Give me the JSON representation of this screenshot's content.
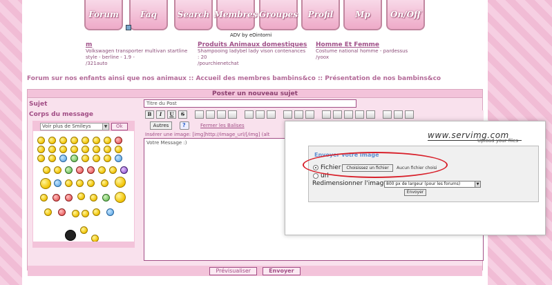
{
  "nav": {
    "buttons": [
      "Forum",
      "Faq",
      "Search",
      "Membres",
      "Groupes",
      "Profil",
      "Mp",
      "On/Off"
    ]
  },
  "adv": "ADV by eOintorni",
  "ads": [
    {
      "title": "m",
      "desc": "Volkswagen transporter multivan startline style - berline - 1.9 -",
      "url": "/321auto"
    },
    {
      "title": "Produits Animaux domestiques",
      "desc": "Shampooing ladybel lady vison contenances : 20",
      "url": "/pourchienetchat"
    },
    {
      "title": "Homme Et Femme",
      "desc": "Costume national homme - pardessus",
      "url": "/yoox"
    }
  ],
  "breadcrumb": {
    "a": "Forum sur nos enfants ainsi que nos animaux",
    "sep1": " :: ",
    "b": "Accueil des membres bambins&co",
    "sep2": " :: ",
    "c": "Présentation de nos bambins&co"
  },
  "post": {
    "header": "Poster un nouveau sujet",
    "subject_label": "Sujet",
    "subject_value": "Titre du Post",
    "body_label": "Corps du message",
    "smileys_select": "Voir plus de Smileys",
    "ok": "Ok",
    "autres": "Autres",
    "close_tags": "Fermer les Balises",
    "insert_hint": "Insérer une image: [img]http://image_url/[/img] (alt",
    "message_value": "Votre Message  :)",
    "preview": "Prévisualiser",
    "send": "Envoyer"
  },
  "toolbar": {
    "bold": "B",
    "italic": "I",
    "underline": "U",
    "strike": "S"
  },
  "servimg": {
    "logo": "www.servimg.com",
    "sub": "Upload your files",
    "title": "Envoyer votre image",
    "fichier": "Fichier",
    "choose": "Choisissez un fichier",
    "no_file": "Aucun fichier choisi",
    "url": "url",
    "resize_label": "Redimensionner l'image",
    "resize_value": "800 px de largeur (pour les forums)",
    "send": "Envoyer"
  },
  "colors": {
    "accent": "#a14d85",
    "pink_bg": "#f3c3da",
    "highlight": "#d8202a"
  }
}
